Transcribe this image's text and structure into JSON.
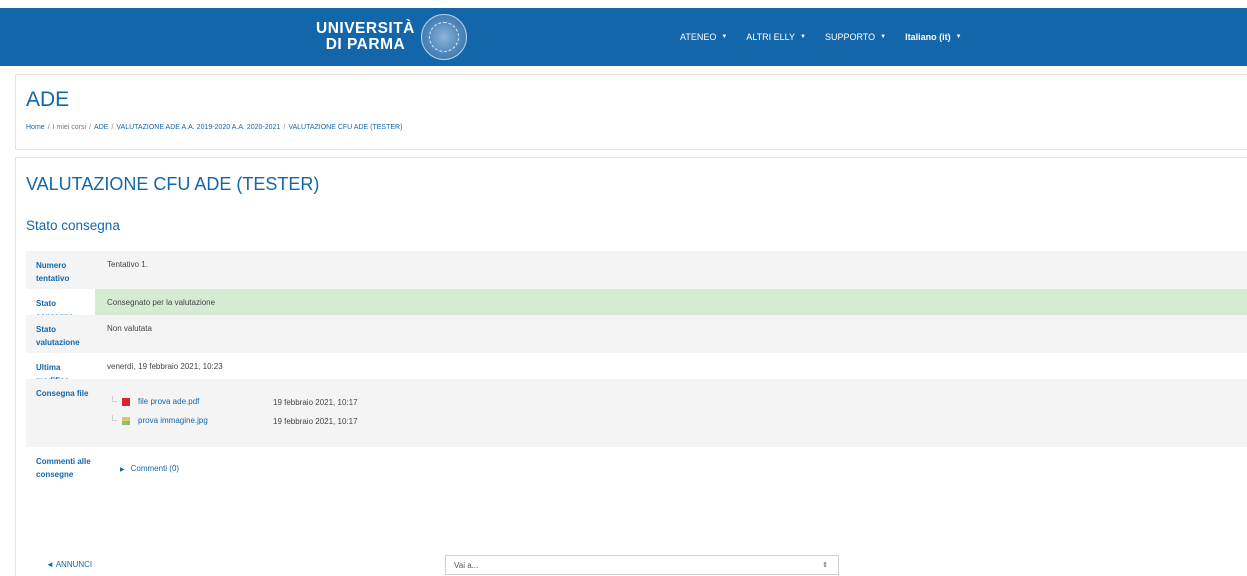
{
  "navbar": {
    "logo_line1": "UNIVERSITÀ",
    "logo_line2": "DI PARMA",
    "menu": [
      {
        "label": "ATENEO"
      },
      {
        "label": "ALTRI ELLY"
      },
      {
        "label": "SUPPORTO"
      },
      {
        "label": "Italiano (it)"
      }
    ]
  },
  "header": {
    "title": "ADE",
    "breadcrumb": [
      "Home",
      "I miei corsi",
      "ADE",
      "VALUTAZIONE ADE A.A. 2019-2020 A.A. 2020-2021",
      "VALUTAZIONE CFU ADE (TESTER)"
    ]
  },
  "main": {
    "activity_title": "VALUTAZIONE CFU ADE (TESTER)",
    "section_title": "Stato consegna",
    "rows": [
      {
        "label_line1": "Numero",
        "label_line2": "tentativo",
        "value": "Tentativo 1."
      },
      {
        "label_line1": "Stato consegna",
        "label_line2": "",
        "value": "Consegnato per la valutazione"
      },
      {
        "label_line1": "Stato",
        "label_line2": "valutazione",
        "value": "Non valutata"
      },
      {
        "label_line1": "Ultima modifica",
        "label_line2": "",
        "value": "venerdì, 19 febbraio 2021, 10:23"
      },
      {
        "label_line1": "Consegna file",
        "label_line2": "",
        "value": ""
      },
      {
        "label_line1": "Commenti alle",
        "label_line2": "consegne",
        "value": ""
      }
    ],
    "files": [
      {
        "name": "file prova ade.pdf",
        "date": "19 febbraio 2021, 10:17",
        "icon": "pdf-file-icon"
      },
      {
        "name": "prova immagine.jpg",
        "date": "19 febbraio 2021, 10:17",
        "icon": "image-file-icon"
      }
    ],
    "comments_label": "Commenti (0)"
  },
  "footer": {
    "prev_link": "◄ ANNUNCI",
    "jump_placeholder": "Vai a..."
  },
  "colors": {
    "brand": "#1466aa",
    "success_row": "#d5ecd3"
  }
}
